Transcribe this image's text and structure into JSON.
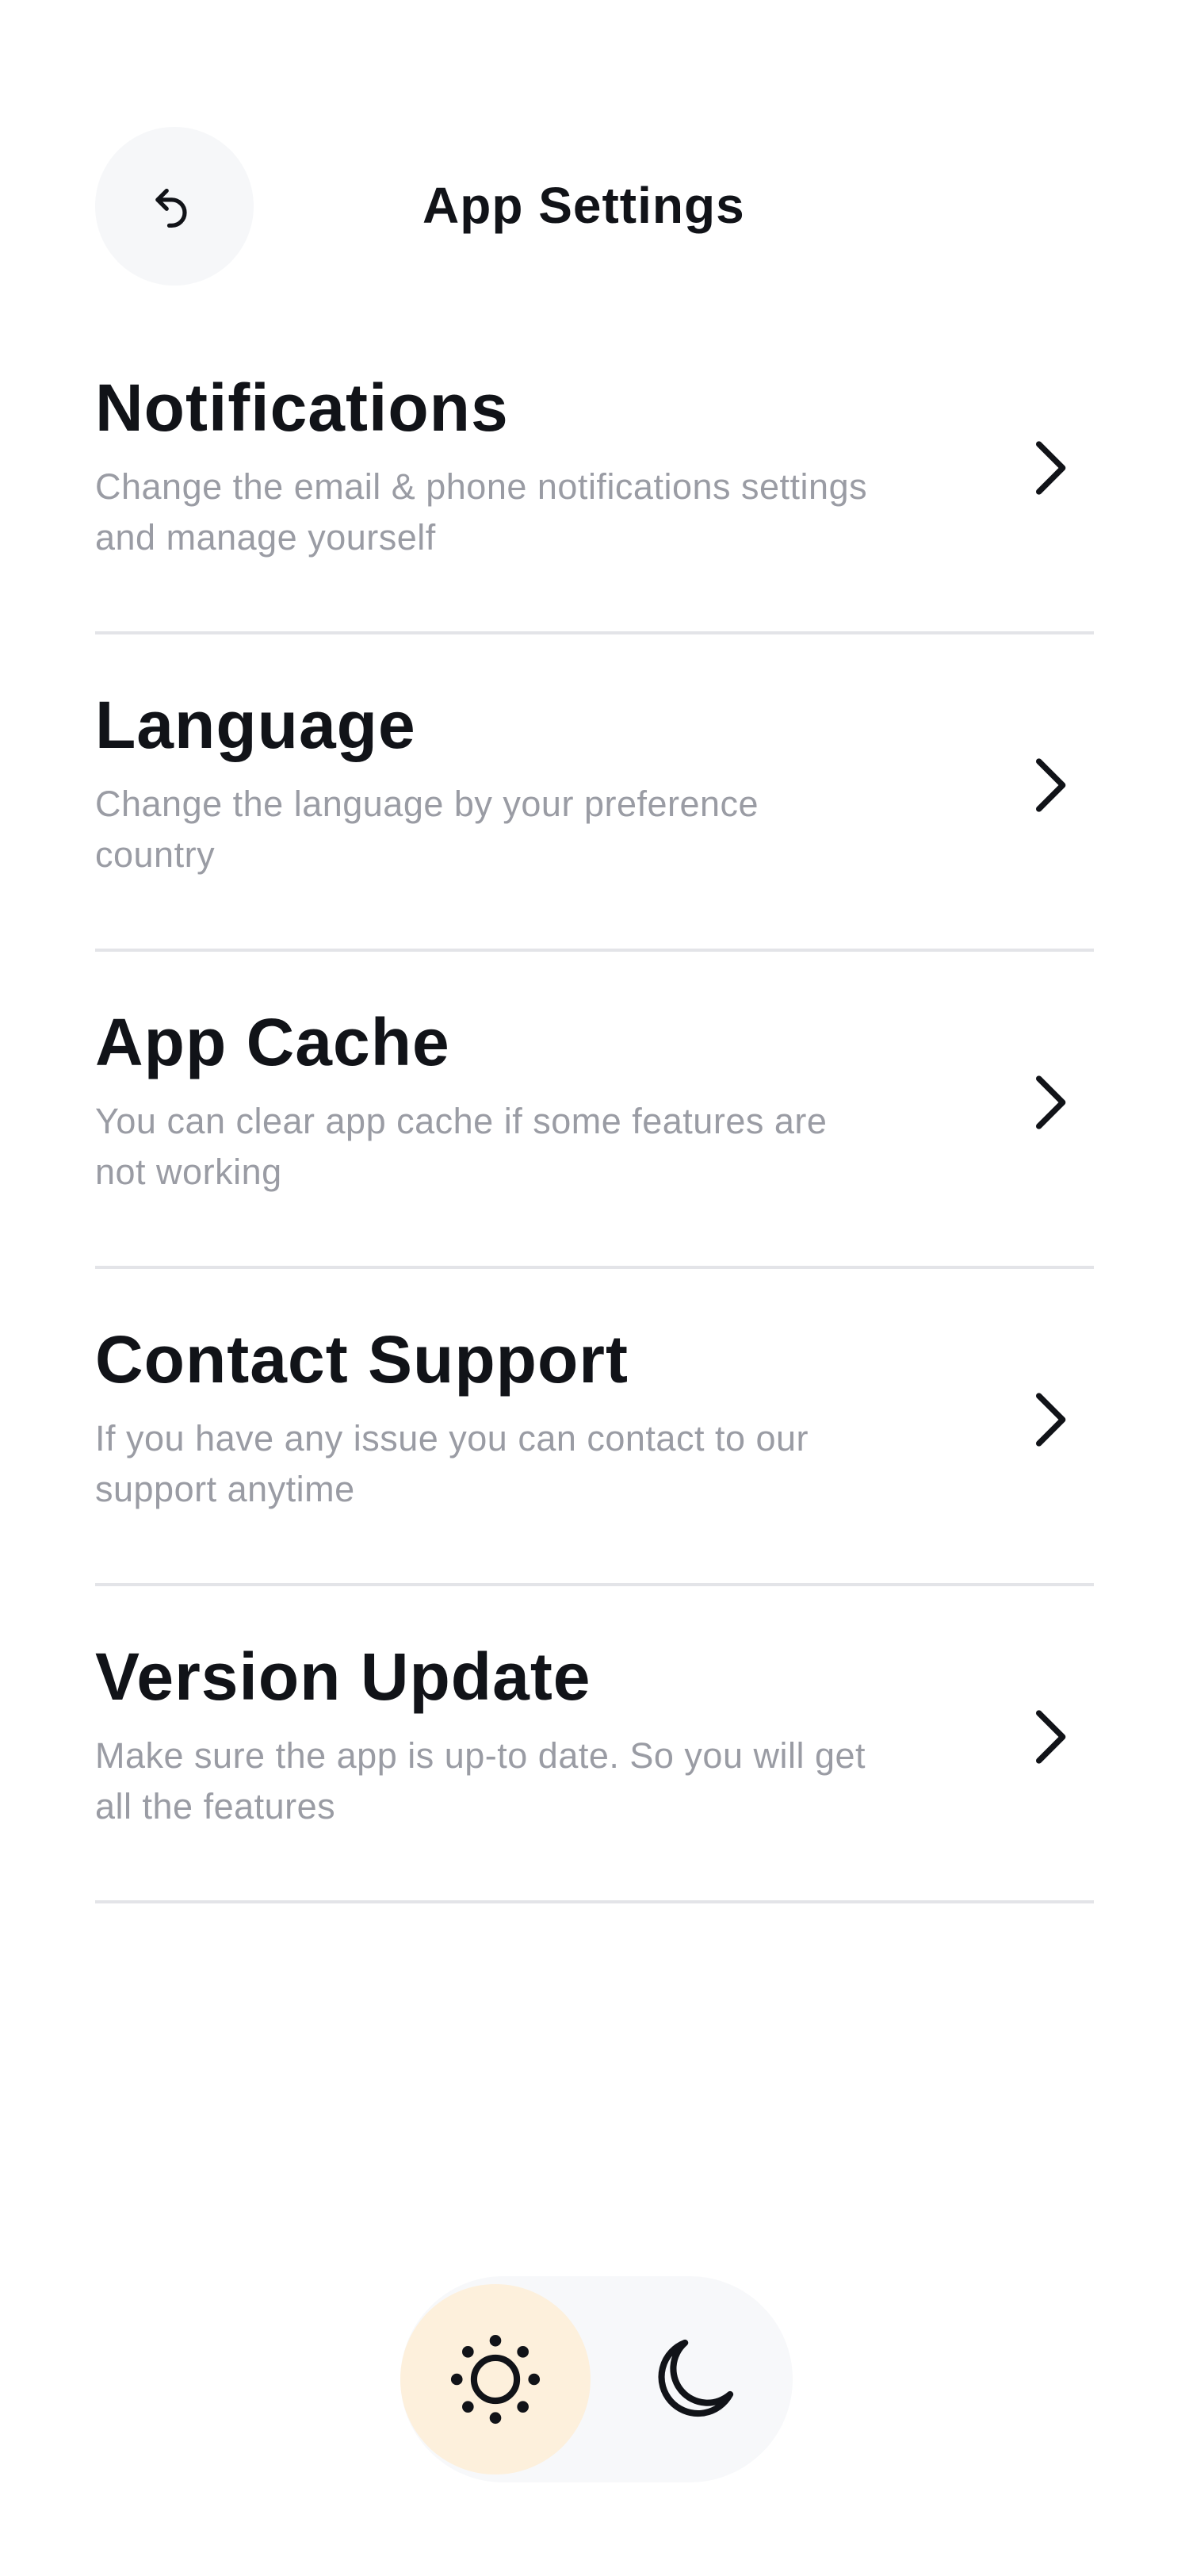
{
  "header": {
    "title": "App Settings",
    "back_icon": "undo-arrow-icon"
  },
  "settings": [
    {
      "title": "Notifications",
      "description": "Change the email & phone notifications settings and manage yourself",
      "icon": "chevron-right-icon"
    },
    {
      "title": "Language",
      "description": "Change the language by your preference country",
      "icon": "chevron-right-icon"
    },
    {
      "title": "App Cache",
      "description": "You can clear app cache if some features are not working",
      "icon": "chevron-right-icon"
    },
    {
      "title": "Contact Support",
      "description": "If you have any issue you can contact to our support anytime",
      "icon": "chevron-right-icon"
    },
    {
      "title": "Version Update",
      "description": "Make sure the app is up-to date. So you will get all the features",
      "icon": "chevron-right-icon"
    }
  ],
  "theme_toggle": {
    "selected": "light",
    "options": [
      {
        "mode": "light",
        "icon": "sun-icon"
      },
      {
        "mode": "dark",
        "icon": "moon-icon"
      }
    ]
  },
  "colors": {
    "title_text": "#111318",
    "description_text": "#9a9ca4",
    "divider": "#e3e4e8",
    "back_button_bg": "#f6f7f9",
    "toggle_bg": "#f7f8fa",
    "light_selected_bg": "#fdf0dc"
  }
}
